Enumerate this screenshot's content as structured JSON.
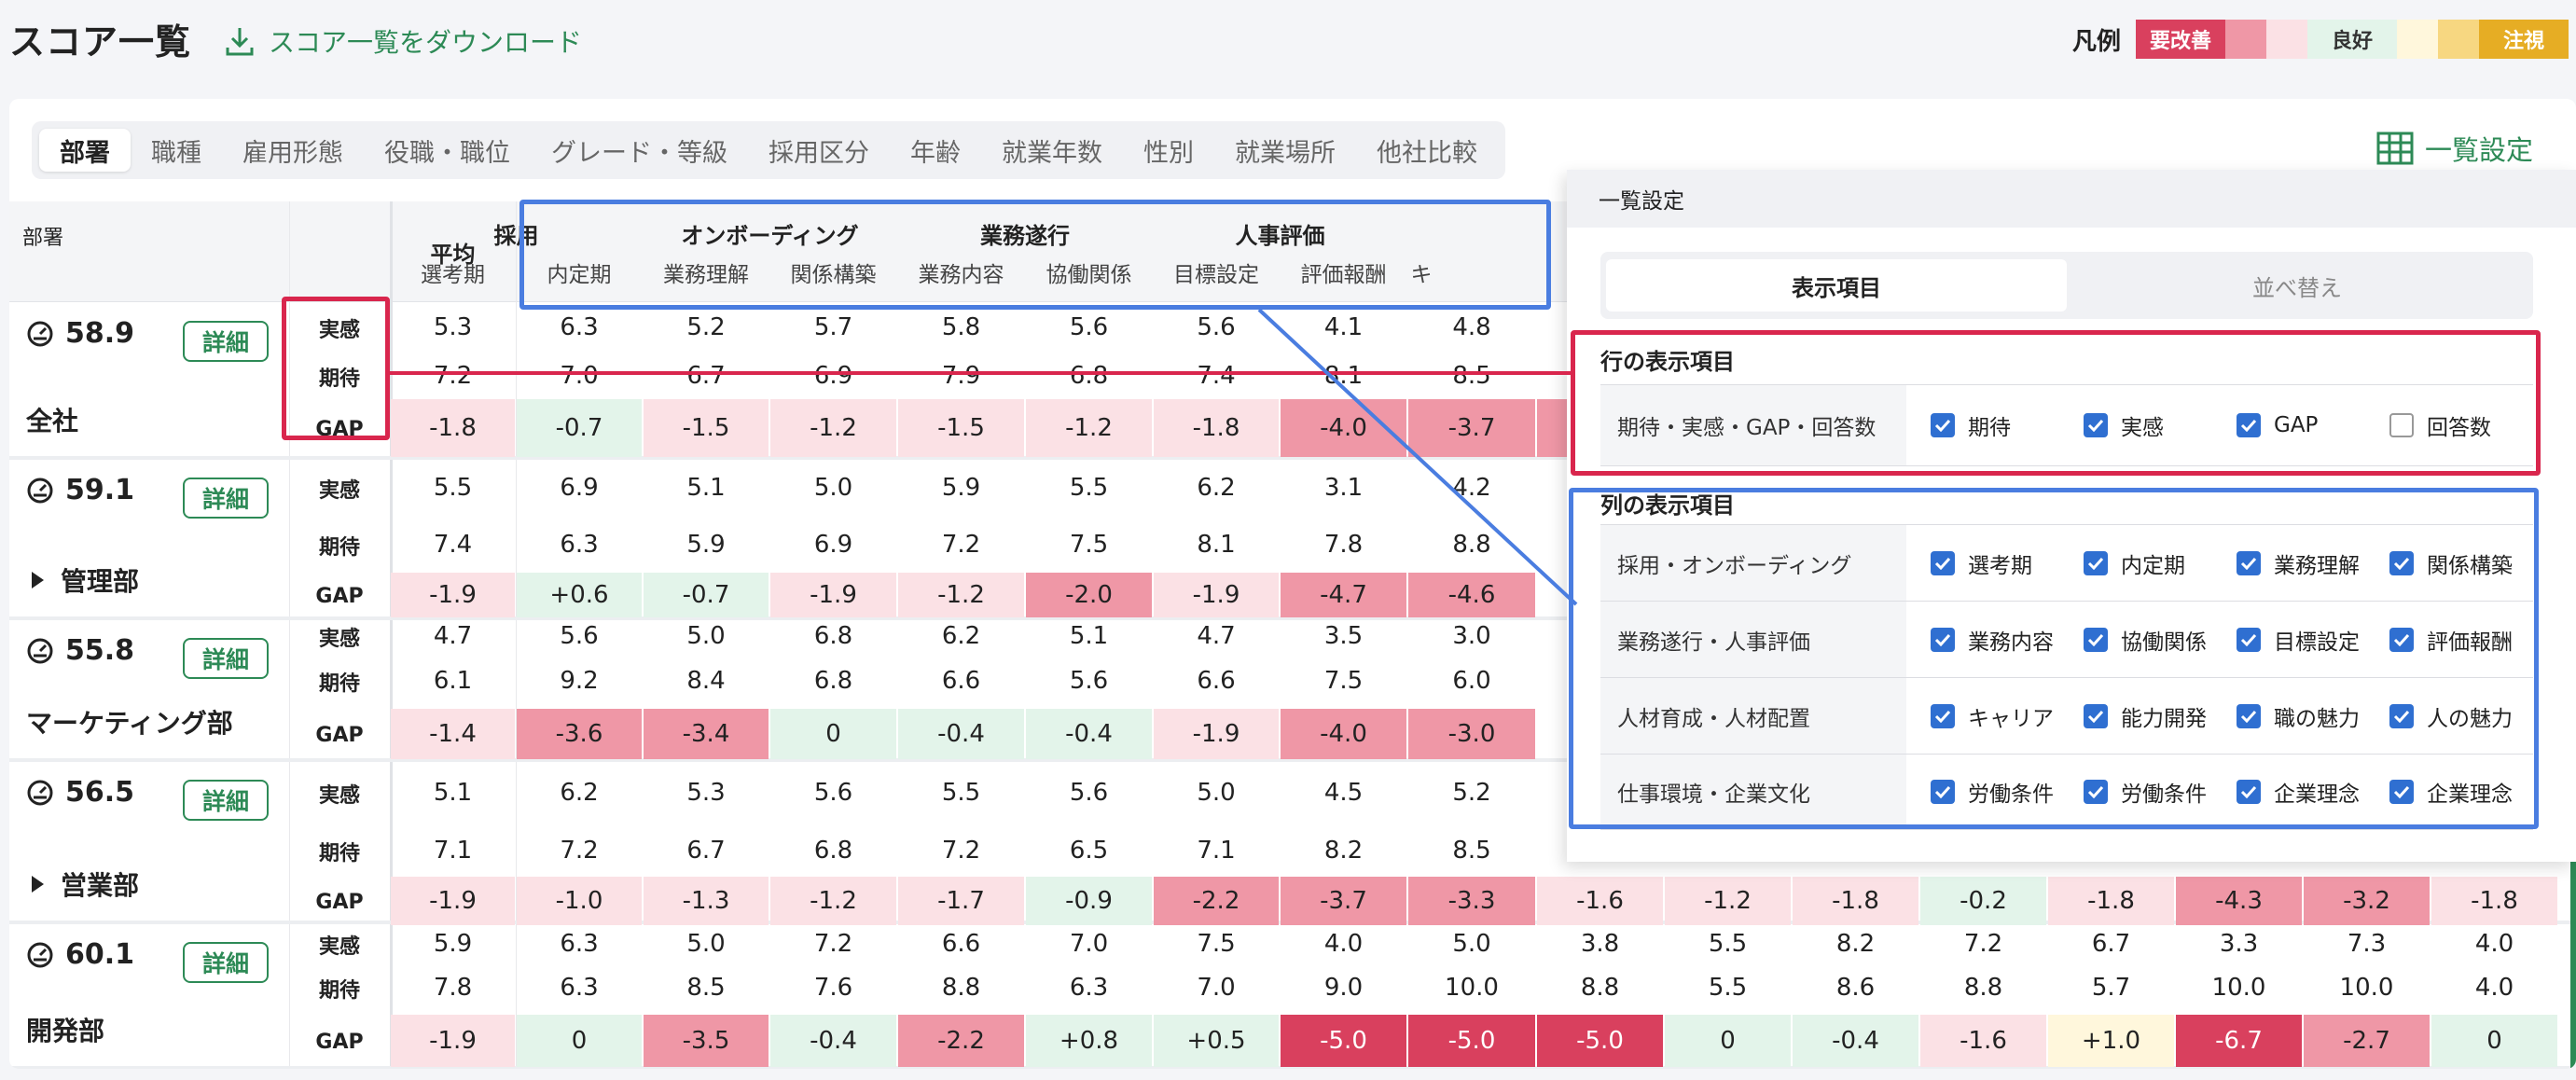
{
  "header": {
    "title": "スコア一覧",
    "download_label": "スコア一覧をダウンロード"
  },
  "legend": {
    "title": "凡例",
    "swatches": [
      {
        "label": "要改善",
        "bg": "#d9405e",
        "fg": "#ffffff"
      },
      {
        "label": "",
        "bg": "#ef97a6",
        "fg": "#ffffff"
      },
      {
        "label": "",
        "bg": "#fbe1e5",
        "fg": "#ffffff"
      },
      {
        "label": "良好",
        "bg": "#e3f4ea",
        "fg": "#333333"
      },
      {
        "label": "",
        "bg": "#fff7dc",
        "fg": "#333333"
      },
      {
        "label": "",
        "bg": "#f7d781",
        "fg": "#333333"
      },
      {
        "label": "注視",
        "bg": "#e6ad24",
        "fg": "#ffffff"
      }
    ]
  },
  "tabs": [
    "部署",
    "職種",
    "雇用形態",
    "役職・職位",
    "グレード・等級",
    "採用区分",
    "年齢",
    "就業年数",
    "性別",
    "就業場所",
    "他社比較"
  ],
  "list_settings_label": "一覧設定",
  "table": {
    "dept_header": "部署",
    "avg_header": "平均",
    "groups": [
      {
        "label": "採用",
        "cols": [
          "選考期",
          "内定期"
        ]
      },
      {
        "label": "オンボーディング",
        "cols": [
          "業務理解",
          "関係構築"
        ]
      },
      {
        "label": "業務遂行",
        "cols": [
          "業務内容",
          "協働関係"
        ]
      },
      {
        "label": "人事評価",
        "cols": [
          "目標設定",
          "評価報酬"
        ]
      }
    ],
    "cut_header": "キ",
    "detail_label": "詳細",
    "rows": [
      {
        "score": "58.9",
        "dept": "全社",
        "expandable": false,
        "lines": [
          {
            "label": "実感",
            "cells": [
              [
                "5.3",
                ""
              ],
              [
                "6.3",
                ""
              ],
              [
                "5.2",
                ""
              ],
              [
                "5.7",
                ""
              ],
              [
                "5.8",
                ""
              ],
              [
                "5.6",
                ""
              ],
              [
                "5.6",
                ""
              ],
              [
                "4.1",
                ""
              ],
              [
                "4.8",
                ""
              ]
            ]
          },
          {
            "label": "期待",
            "cells": [
              [
                "7.2",
                ""
              ],
              [
                "7.0",
                ""
              ],
              [
                "6.7",
                ""
              ],
              [
                "6.9",
                ""
              ],
              [
                "7.9",
                ""
              ],
              [
                "6.8",
                ""
              ],
              [
                "7.4",
                ""
              ],
              [
                "8.1",
                ""
              ],
              [
                "8.5",
                ""
              ]
            ]
          },
          {
            "label": "GAP",
            "cells": [
              [
                "-1.8",
                "p1"
              ],
              [
                "-0.7",
                "g"
              ],
              [
                "-1.5",
                "p1"
              ],
              [
                "-1.2",
                "p1"
              ],
              [
                "-1.5",
                "p1"
              ],
              [
                "-1.2",
                "p1"
              ],
              [
                "-1.8",
                "p1"
              ],
              [
                "-4.0",
                "p2"
              ],
              [
                "-3.7",
                "p2"
              ],
              [
                "",
                "p2"
              ]
            ]
          }
        ]
      },
      {
        "score": "59.1",
        "dept": "管理部",
        "expandable": true,
        "lines": [
          {
            "label": "実感",
            "cells": [
              [
                "5.5",
                ""
              ],
              [
                "6.9",
                ""
              ],
              [
                "5.1",
                ""
              ],
              [
                "5.0",
                ""
              ],
              [
                "5.9",
                ""
              ],
              [
                "5.5",
                ""
              ],
              [
                "6.2",
                ""
              ],
              [
                "3.1",
                ""
              ],
              [
                "4.2",
                ""
              ]
            ]
          },
          {
            "label": "期待",
            "cells": [
              [
                "7.4",
                ""
              ],
              [
                "6.3",
                ""
              ],
              [
                "5.9",
                ""
              ],
              [
                "6.9",
                ""
              ],
              [
                "7.2",
                ""
              ],
              [
                "7.5",
                ""
              ],
              [
                "8.1",
                ""
              ],
              [
                "7.8",
                ""
              ],
              [
                "8.8",
                ""
              ]
            ]
          },
          {
            "label": "GAP",
            "cells": [
              [
                "-1.9",
                "p1"
              ],
              [
                "+0.6",
                "g"
              ],
              [
                "-0.7",
                "g"
              ],
              [
                "-1.9",
                "p1"
              ],
              [
                "-1.2",
                "p1"
              ],
              [
                "-2.0",
                "p2"
              ],
              [
                "-1.9",
                "p1"
              ],
              [
                "-4.7",
                "p2"
              ],
              [
                "-4.6",
                "p2"
              ]
            ]
          }
        ]
      },
      {
        "score": "55.8",
        "dept": "マーケティング部",
        "expandable": false,
        "lines": [
          {
            "label": "実感",
            "cells": [
              [
                "4.7",
                ""
              ],
              [
                "5.6",
                ""
              ],
              [
                "5.0",
                ""
              ],
              [
                "6.8",
                ""
              ],
              [
                "6.2",
                ""
              ],
              [
                "5.1",
                ""
              ],
              [
                "4.7",
                ""
              ],
              [
                "3.5",
                ""
              ],
              [
                "3.0",
                ""
              ]
            ]
          },
          {
            "label": "期待",
            "cells": [
              [
                "6.1",
                ""
              ],
              [
                "9.2",
                ""
              ],
              [
                "8.4",
                ""
              ],
              [
                "6.8",
                ""
              ],
              [
                "6.6",
                ""
              ],
              [
                "5.6",
                ""
              ],
              [
                "6.6",
                ""
              ],
              [
                "7.5",
                ""
              ],
              [
                "6.0",
                ""
              ]
            ]
          },
          {
            "label": "GAP",
            "cells": [
              [
                "-1.4",
                "p1"
              ],
              [
                "-3.6",
                "p2"
              ],
              [
                "-3.4",
                "p2"
              ],
              [
                "0",
                "g"
              ],
              [
                "-0.4",
                "g"
              ],
              [
                "-0.4",
                "g"
              ],
              [
                "-1.9",
                "p1"
              ],
              [
                "-4.0",
                "p2"
              ],
              [
                "-3.0",
                "p2"
              ]
            ]
          }
        ]
      },
      {
        "score": "56.5",
        "dept": "営業部",
        "expandable": true,
        "lines": [
          {
            "label": "実感",
            "cells": [
              [
                "5.1",
                ""
              ],
              [
                "6.2",
                ""
              ],
              [
                "5.3",
                ""
              ],
              [
                "5.6",
                ""
              ],
              [
                "5.5",
                ""
              ],
              [
                "5.6",
                ""
              ],
              [
                "5.0",
                ""
              ],
              [
                "4.5",
                ""
              ],
              [
                "5.2",
                ""
              ]
            ]
          },
          {
            "label": "期待",
            "cells": [
              [
                "7.1",
                ""
              ],
              [
                "7.2",
                ""
              ],
              [
                "6.7",
                ""
              ],
              [
                "6.8",
                ""
              ],
              [
                "7.2",
                ""
              ],
              [
                "6.5",
                ""
              ],
              [
                "7.1",
                ""
              ],
              [
                "8.2",
                ""
              ],
              [
                "8.5",
                ""
              ]
            ]
          },
          {
            "label": "GAP",
            "cells": [
              [
                "-1.9",
                "p1"
              ],
              [
                "-1.0",
                "p1"
              ],
              [
                "-1.3",
                "p1"
              ],
              [
                "-1.2",
                "p1"
              ],
              [
                "-1.7",
                "p1"
              ],
              [
                "-0.9",
                "g"
              ],
              [
                "-2.2",
                "p2"
              ],
              [
                "-3.7",
                "p2"
              ],
              [
                "-3.3",
                "p2"
              ],
              [
                "-1.6",
                "p1"
              ],
              [
                "-1.2",
                "p1"
              ],
              [
                "-1.8",
                "p1"
              ],
              [
                "-0.2",
                "g"
              ],
              [
                "-1.8",
                "p1"
              ],
              [
                "-4.3",
                "p2"
              ],
              [
                "-3.2",
                "p2"
              ],
              [
                "-1.8",
                "p1"
              ]
            ]
          }
        ]
      },
      {
        "score": "60.1",
        "dept": "開発部",
        "expandable": false,
        "lines": [
          {
            "label": "実感",
            "cells": [
              [
                "5.9",
                ""
              ],
              [
                "6.3",
                ""
              ],
              [
                "5.0",
                ""
              ],
              [
                "7.2",
                ""
              ],
              [
                "6.6",
                ""
              ],
              [
                "7.0",
                ""
              ],
              [
                "7.5",
                ""
              ],
              [
                "4.0",
                ""
              ],
              [
                "5.0",
                ""
              ],
              [
                "3.8",
                ""
              ],
              [
                "5.5",
                ""
              ],
              [
                "8.2",
                ""
              ],
              [
                "7.2",
                ""
              ],
              [
                "6.7",
                ""
              ],
              [
                "3.3",
                ""
              ],
              [
                "7.3",
                ""
              ],
              [
                "4.0",
                ""
              ]
            ]
          },
          {
            "label": "期待",
            "cells": [
              [
                "7.8",
                ""
              ],
              [
                "6.3",
                ""
              ],
              [
                "8.5",
                ""
              ],
              [
                "7.6",
                ""
              ],
              [
                "8.8",
                ""
              ],
              [
                "6.3",
                ""
              ],
              [
                "7.0",
                ""
              ],
              [
                "9.0",
                ""
              ],
              [
                "10.0",
                ""
              ],
              [
                "8.8",
                ""
              ],
              [
                "5.5",
                ""
              ],
              [
                "8.6",
                ""
              ],
              [
                "8.8",
                ""
              ],
              [
                "5.7",
                ""
              ],
              [
                "10.0",
                ""
              ],
              [
                "10.0",
                ""
              ],
              [
                "4.0",
                ""
              ]
            ]
          },
          {
            "label": "GAP",
            "cells": [
              [
                "-1.9",
                "p1"
              ],
              [
                "0",
                "g"
              ],
              [
                "-3.5",
                "p2"
              ],
              [
                "-0.4",
                "g"
              ],
              [
                "-2.2",
                "p2"
              ],
              [
                "+0.8",
                "g"
              ],
              [
                "+0.5",
                "g"
              ],
              [
                "-5.0",
                "p3"
              ],
              [
                "-5.0",
                "p3"
              ],
              [
                "-5.0",
                "p3"
              ],
              [
                "0",
                "g"
              ],
              [
                "-0.4",
                "g"
              ],
              [
                "-1.6",
                "p1"
              ],
              [
                "+1.0",
                "y"
              ],
              [
                "-6.7",
                "p3"
              ],
              [
                "-2.7",
                "p2"
              ],
              [
                "0",
                "g"
              ]
            ]
          }
        ]
      }
    ]
  },
  "panel": {
    "title": "一覧設定",
    "tabs": [
      "表示項目",
      "並べ替え"
    ],
    "row_section_title": "行の表示項目",
    "row_items": {
      "label": "期待・実感・GAP・回答数",
      "options": [
        {
          "text": "期待",
          "checked": true
        },
        {
          "text": "実感",
          "checked": true
        },
        {
          "text": "GAP",
          "checked": true
        },
        {
          "text": "回答数",
          "checked": false
        }
      ]
    },
    "col_section_title": "列の表示項目",
    "col_items": [
      {
        "label": "採用・オンボーディング",
        "options": [
          "選考期",
          "内定期",
          "業務理解",
          "関係構築"
        ]
      },
      {
        "label": "業務遂行・人事評価",
        "options": [
          "業務内容",
          "協働関係",
          "目標設定",
          "評価報酬"
        ]
      },
      {
        "label": "人材育成・人材配置",
        "options": [
          "キャリア",
          "能力開発",
          "職の魅力",
          "人の魅力"
        ]
      },
      {
        "label": "仕事環境・企業文化",
        "options": [
          "労働条件",
          "労働条件",
          "企業理念",
          "企業理念"
        ]
      }
    ]
  },
  "colors": {
    "accent_green": "#2d8a56",
    "annotation_red": "#d9264d",
    "annotation_blue": "#4a7de0",
    "check_blue": "#2f6fd1",
    "cell": {
      "g": "#e3f4ea",
      "p1": "#fbe1e5",
      "p2": "#ef97a6",
      "p3": "#d9405e",
      "y": "#fff7dc"
    }
  }
}
